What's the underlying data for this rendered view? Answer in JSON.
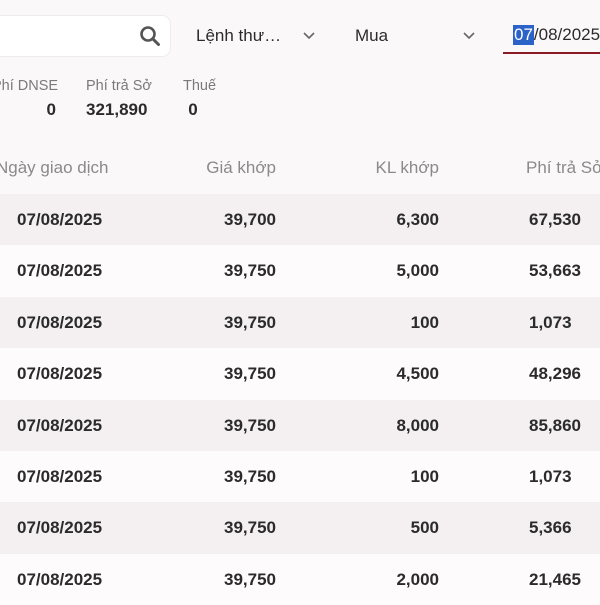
{
  "toolbar": {
    "search_icon": "search-icon",
    "order_type_label": "Lệnh thư…",
    "side_label": "Mua",
    "date_selected": "07",
    "date_rest": "/08/2025",
    "chevron_icon": "chevron-down-icon"
  },
  "summary": {
    "dnse_label": "Phí DNSE",
    "dnse_value": "0",
    "fee_label": "Phí trả Sở",
    "fee_value": "321,890",
    "tax_label": "Thuế",
    "tax_value": "0"
  },
  "table": {
    "headers": {
      "date": "Ngày giao dịch",
      "price": "Giá khớp",
      "qty": "KL khớp",
      "fee": "Phí trả Sở"
    },
    "rows": [
      {
        "date": "07/08/2025",
        "price": "39,700",
        "qty": "6,300",
        "fee": "67,530"
      },
      {
        "date": "07/08/2025",
        "price": "39,750",
        "qty": "5,000",
        "fee": "53,663"
      },
      {
        "date": "07/08/2025",
        "price": "39,750",
        "qty": "100",
        "fee": "1,073"
      },
      {
        "date": "07/08/2025",
        "price": "39,750",
        "qty": "4,500",
        "fee": "48,296"
      },
      {
        "date": "07/08/2025",
        "price": "39,750",
        "qty": "8,000",
        "fee": "85,860"
      },
      {
        "date": "07/08/2025",
        "price": "39,750",
        "qty": "100",
        "fee": "1,073"
      },
      {
        "date": "07/08/2025",
        "price": "39,750",
        "qty": "500",
        "fee": "5,366"
      },
      {
        "date": "07/08/2025",
        "price": "39,750",
        "qty": "2,000",
        "fee": "21,465"
      }
    ]
  },
  "colors": {
    "accent_underline": "#8a1a24",
    "selection": "#2b63c9",
    "row_alt": "#f4eff1"
  }
}
